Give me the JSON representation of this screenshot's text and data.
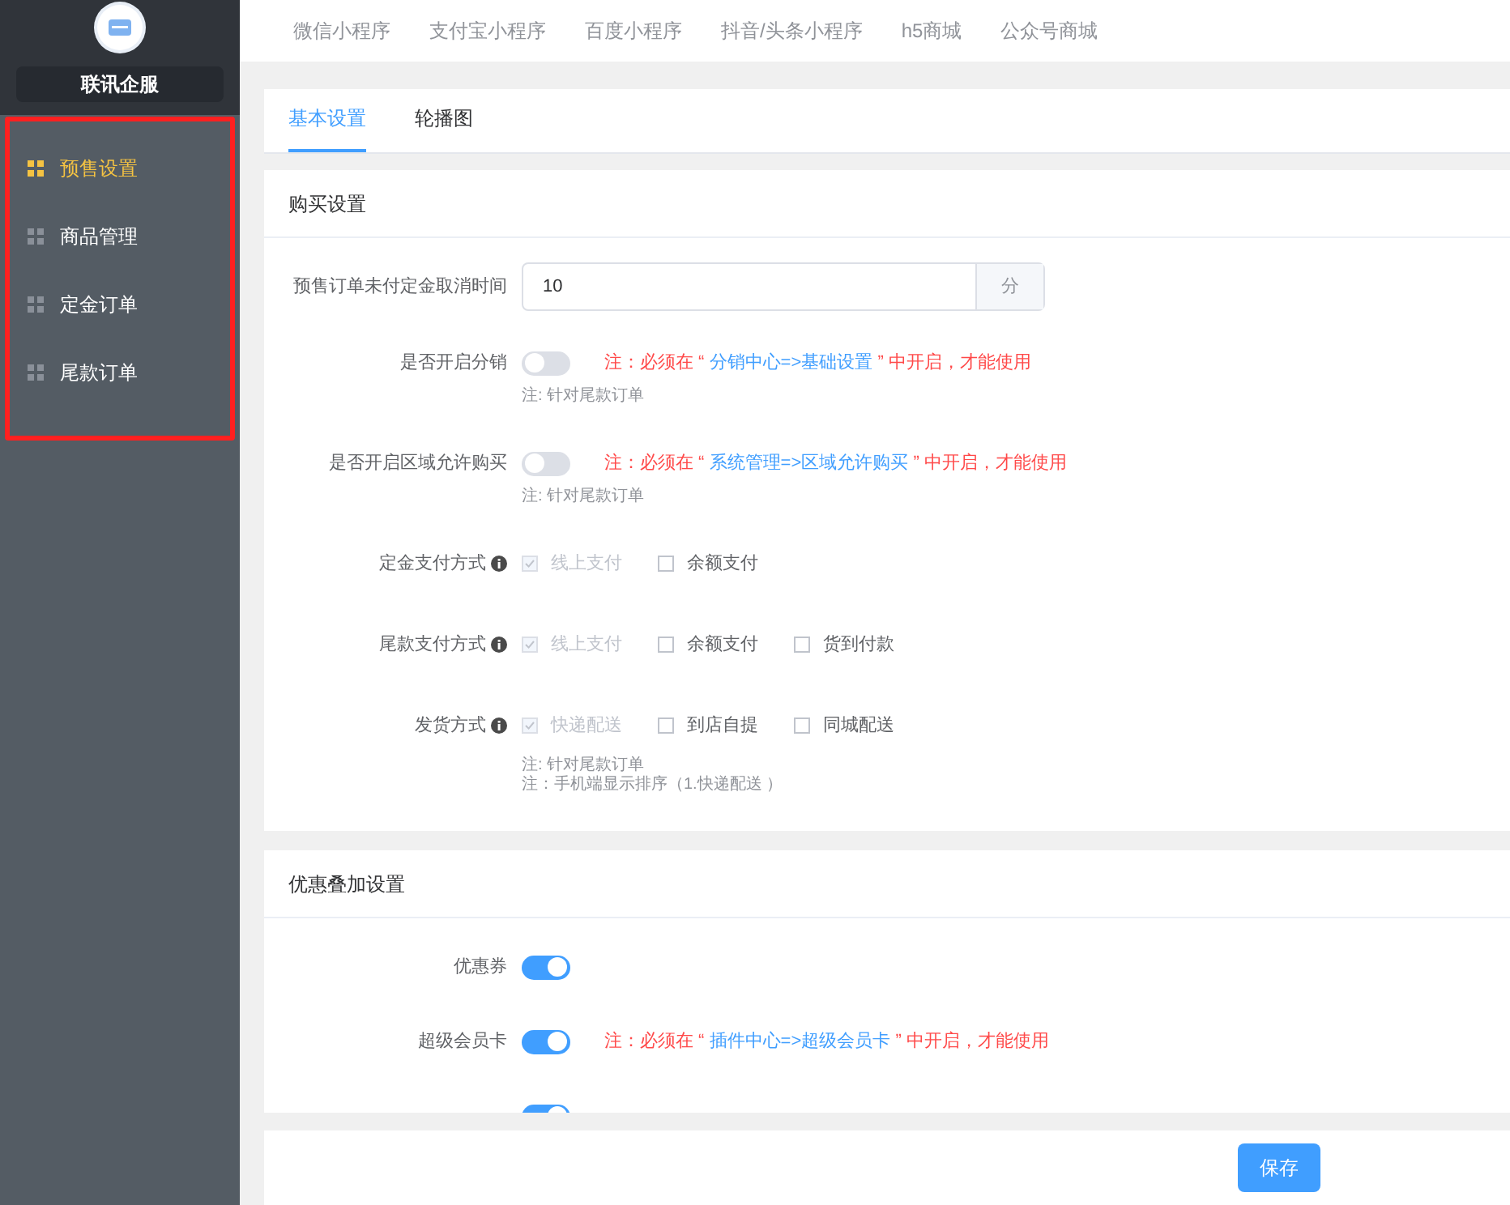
{
  "sidebar": {
    "brand": "联讯企服",
    "items": [
      {
        "label": "预售设置",
        "selected": true
      },
      {
        "label": "商品管理",
        "selected": false
      },
      {
        "label": "定金订单",
        "selected": false
      },
      {
        "label": "尾款订单",
        "selected": false
      }
    ]
  },
  "top_tabs": [
    "微信小程序",
    "支付宝小程序",
    "百度小程序",
    "抖音/头条小程序",
    "h5商城",
    "公众号商城"
  ],
  "tabs": [
    {
      "label": "基本设置",
      "selected": true
    },
    {
      "label": "轮播图",
      "selected": false
    }
  ],
  "sections": [
    {
      "title": "购买设置",
      "rows": [
        {
          "kind": "input",
          "label": "预售订单未付定金取消时间",
          "value": "10",
          "unit": "分"
        },
        {
          "kind": "switch",
          "label": "是否开启分销",
          "on": false,
          "note": {
            "before": "注：必须在 “",
            "link": "分销中心=>基础设置",
            "after": "” 中开启，才能使用"
          },
          "hints": [
            "注: 针对尾款订单"
          ]
        },
        {
          "kind": "switch",
          "label": "是否开启区域允许购买",
          "on": false,
          "note": {
            "before": "注：必须在 “",
            "link": "系统管理=>区域允许购买",
            "after": "” 中开启，才能使用"
          },
          "hints": [
            "注: 针对尾款订单"
          ]
        },
        {
          "kind": "checks",
          "label": "定金支付方式",
          "options": [
            {
              "label": "线上支付",
              "checked": true,
              "disabled": true
            },
            {
              "label": "余额支付",
              "checked": false,
              "disabled": false
            }
          ]
        },
        {
          "kind": "checks",
          "label": "尾款支付方式",
          "options": [
            {
              "label": "线上支付",
              "checked": true,
              "disabled": true
            },
            {
              "label": "余额支付",
              "checked": false,
              "disabled": false
            },
            {
              "label": "货到付款",
              "checked": false,
              "disabled": false
            }
          ]
        },
        {
          "kind": "checks",
          "label": "发货方式",
          "options": [
            {
              "label": "快递配送",
              "checked": true,
              "disabled": true
            },
            {
              "label": "到店自提",
              "checked": false,
              "disabled": false
            },
            {
              "label": "同城配送",
              "checked": false,
              "disabled": false
            }
          ],
          "hints": [
            "注: 针对尾款订单",
            "注：手机端显示排序（1.快递配送 ）"
          ]
        }
      ]
    },
    {
      "title": "优惠叠加设置",
      "rows": [
        {
          "kind": "switch",
          "label": "优惠券",
          "on": true
        },
        {
          "kind": "switch",
          "label": "超级会员卡",
          "on": true,
          "note": {
            "before": "注：必须在 “",
            "link": "插件中心=>超级会员卡",
            "after": "” 中开启，才能使用"
          }
        },
        {
          "kind": "switch",
          "on": true
        }
      ]
    }
  ],
  "save_button": "保存"
}
